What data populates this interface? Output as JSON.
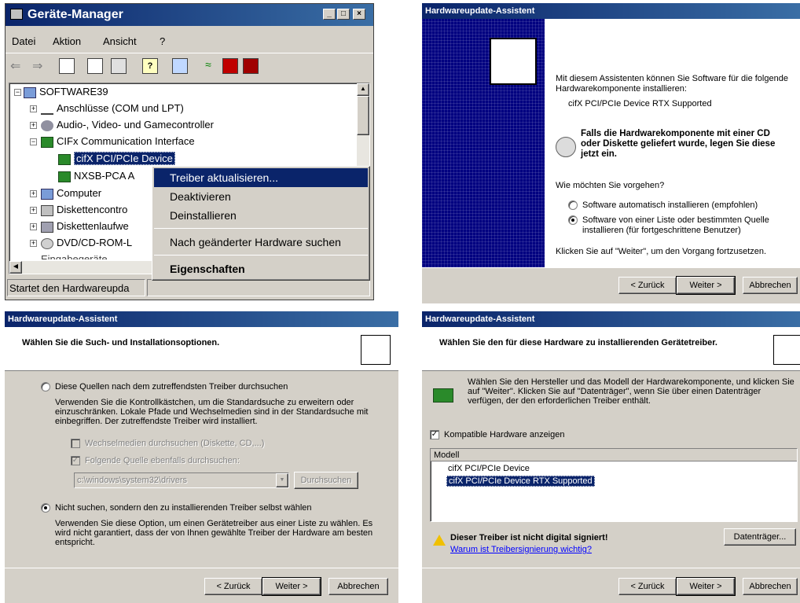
{
  "device_manager": {
    "title": "Geräte-Manager",
    "menu": [
      "Datei",
      "Aktion",
      "Ansicht",
      "?"
    ],
    "tree": {
      "root": "SOFTWARE39",
      "items": [
        "Anschlüsse (COM und LPT)",
        "Audio-, Video- und Gamecontroller",
        "CIFx Communication Interface",
        "cifX PCI/PCIe Device",
        "NXSB-PCA A",
        "Computer",
        "Diskettencontro",
        "Diskettenlaufwe",
        "DVD/CD-ROM-L",
        "Eingabegeräte"
      ]
    },
    "context_menu": {
      "update": "Treiber aktualisieren...",
      "disable": "Deaktivieren",
      "uninstall": "Deinstallieren",
      "scan": "Nach geänderter Hardware suchen",
      "properties": "Eigenschaften"
    },
    "status": "Startet den Hardwareupda"
  },
  "wizard1": {
    "title": "Hardwareupdate-Assistent",
    "intro": "Mit diesem Assistenten können Sie Software für die folgende Hardwarekomponente installieren:",
    "device": "cifX PCI/PCIe Device RTX Supported",
    "cd_hint": "Falls die Hardwarekomponente mit einer CD oder Diskette geliefert wurde, legen Sie diese jetzt ein.",
    "question": "Wie möchten Sie vorgehen?",
    "opt_auto": "Software automatisch installieren (empfohlen)",
    "opt_list": "Software von einer Liste oder bestimmten Quelle installieren (für fortgeschrittene Benutzer)",
    "continue": "Klicken Sie auf \"Weiter\", um den Vorgang fortzusetzen.",
    "back": "< Zurück",
    "next": "Weiter >",
    "cancel": "Abbrechen"
  },
  "wizard2": {
    "title": "Hardwareupdate-Assistent",
    "heading": "Wählen Sie die Such- und Installationsoptionen.",
    "opt_search": "Diese Quellen nach dem zutreffendsten Treiber durchsuchen",
    "search_desc": "Verwenden Sie die Kontrollkästchen, um die Standardsuche zu erweitern oder einzuschränken. Lokale Pfade und Wechselmedien sind in der Standardsuche mit einbegriffen. Der zutreffendste Treiber wird installiert.",
    "chk_removable": "Wechselmedien durchsuchen (Diskette, CD,...)",
    "chk_location": "Folgende Quelle ebenfalls durchsuchen:",
    "path": "c:\\windows\\system32\\drivers",
    "browse": "Durchsuchen",
    "opt_manual": "Nicht suchen, sondern den zu installierenden Treiber selbst wählen",
    "manual_desc": "Verwenden Sie diese Option, um einen Gerätetreiber aus einer Liste zu wählen. Es wird nicht garantiert, dass der von Ihnen gewählte Treiber der Hardware am besten entspricht.",
    "back": "< Zurück",
    "next": "Weiter >",
    "cancel": "Abbrechen"
  },
  "wizard3": {
    "title": "Hardwareupdate-Assistent",
    "heading": "Wählen Sie den für diese Hardware zu installierenden Gerätetreiber.",
    "desc": "Wählen Sie den Hersteller und das Modell der Hardwarekomponente, und klicken Sie auf \"Weiter\". Klicken Sie auf \"Datenträger\", wenn Sie über einen Datenträger verfügen, der den erforderlichen Treiber enthält.",
    "chk_compatible": "Kompatible Hardware anzeigen",
    "list_header": "Modell",
    "models": [
      "cifX PCI/PCIe Device",
      "cifX PCI/PCIe Device RTX Supported"
    ],
    "warning": "Dieser Treiber ist nicht digital signiert!",
    "warning_link": "Warum ist Treibersignierung wichtig?",
    "disk": "Datenträger...",
    "back": "< Zurück",
    "next": "Weiter >",
    "cancel": "Abbrechen"
  },
  "colors": {
    "titlebar": "#0a246a",
    "selection": "#0a246a",
    "face": "#d4d0c8",
    "link": "#0000ff",
    "banner": "#000080"
  }
}
